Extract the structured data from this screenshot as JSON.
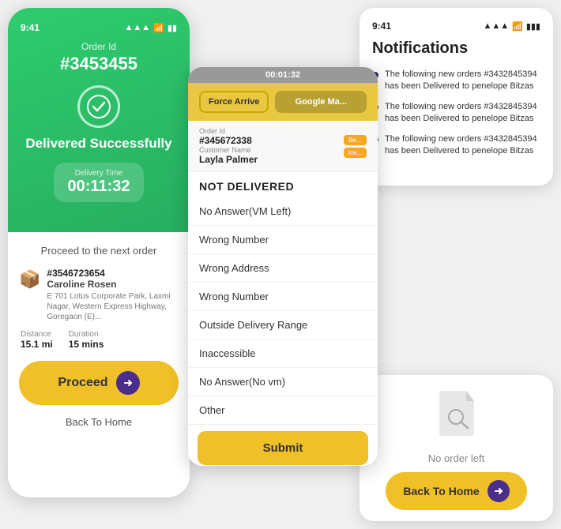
{
  "card_delivered": {
    "status_bar": {
      "time": "9:41",
      "signal": "▲▲▲",
      "wifi": "WiFi",
      "battery": "🔋"
    },
    "order_id_label": "Order Id",
    "order_id": "#3453455",
    "check_icon": "✓",
    "delivered_text": "Delivered Successfully",
    "delivery_time_label": "Delivery Time",
    "delivery_time_value": "00:11:32",
    "next_order_label": "Proceed to the next order",
    "order": {
      "id": "#3546723654",
      "customer": "Caroline Rosen",
      "address": "E 701 Lotus Corporate Park, Laxmi Nagar, Western Express Highway, Goregaon (E)...",
      "distance_label": "Distance",
      "distance_value": "15.1 mi",
      "duration_label": "Duration",
      "duration_value": "15 mins"
    },
    "proceed_btn_label": "Proceed",
    "back_home_label": "Back To Home"
  },
  "card_not_delivered": {
    "time_bar": "00:01:32",
    "force_arrive_label": "Force Arrive",
    "google_maps_label": "Google Ma...",
    "order_id_label": "Order Id",
    "order_id_value": "#345672338",
    "customer_name_label": "Customer Name",
    "customer_name_value": "Layla Palmer",
    "badge1": "Be...",
    "badge2": "Ice...",
    "nd_title": "NOT DELIVERED",
    "options": [
      "No Answer(VM Left)",
      "Wrong Number",
      "Wrong Address",
      "Wrong Number",
      "Outside Delivery Range",
      "Inaccessible",
      "No Answer(No vm)",
      "Other"
    ],
    "submit_label": "Submit"
  },
  "card_notifications": {
    "time": "9:41",
    "title": "Notifications",
    "items": [
      {
        "text": "The following new orders #3432845394 has been Delivered to penelope Bitzas"
      },
      {
        "text": "The following new orders #3432845394 has been Delivered to penelope Bitzas"
      },
      {
        "text": "The following new orders #3432845394 has been Delivered to penelope Bitzas"
      }
    ]
  },
  "card_no_order": {
    "icon": "📄",
    "label": "No order left",
    "back_home_label": "Back To Home"
  }
}
